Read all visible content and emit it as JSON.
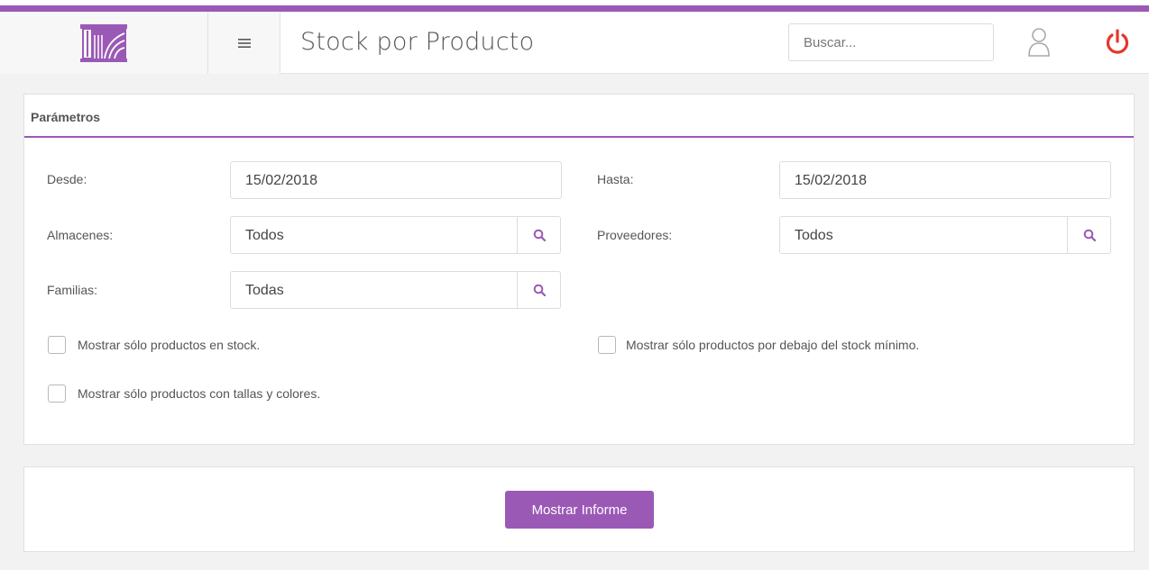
{
  "header": {
    "title": "Stock por Producto",
    "search_placeholder": "Buscar...",
    "logo_icon": "building-logo-icon",
    "menu_icon": "hamburger-icon",
    "user_icon": "user-icon",
    "power_icon": "power-icon"
  },
  "colors": {
    "accent": "#9b59b6",
    "power": "#e8352c"
  },
  "parameters": {
    "title": "Parámetros",
    "desde": {
      "label": "Desde:",
      "value": "15/02/2018"
    },
    "hasta": {
      "label": "Hasta:",
      "value": "15/02/2018"
    },
    "almacenes": {
      "label": "Almacenes:",
      "value": "Todos"
    },
    "proveedores": {
      "label": "Proveedores:",
      "value": "Todos"
    },
    "familias": {
      "label": "Familias:",
      "value": "Todas"
    },
    "checkboxes": [
      {
        "label": "Mostrar sólo productos en stock.",
        "checked": false
      },
      {
        "label": "Mostrar sólo productos por debajo del stock mínimo.",
        "checked": false
      },
      {
        "label": "Mostrar sólo productos con tallas y colores.",
        "checked": false
      }
    ]
  },
  "actions": {
    "report_label": "Mostrar Informe"
  }
}
